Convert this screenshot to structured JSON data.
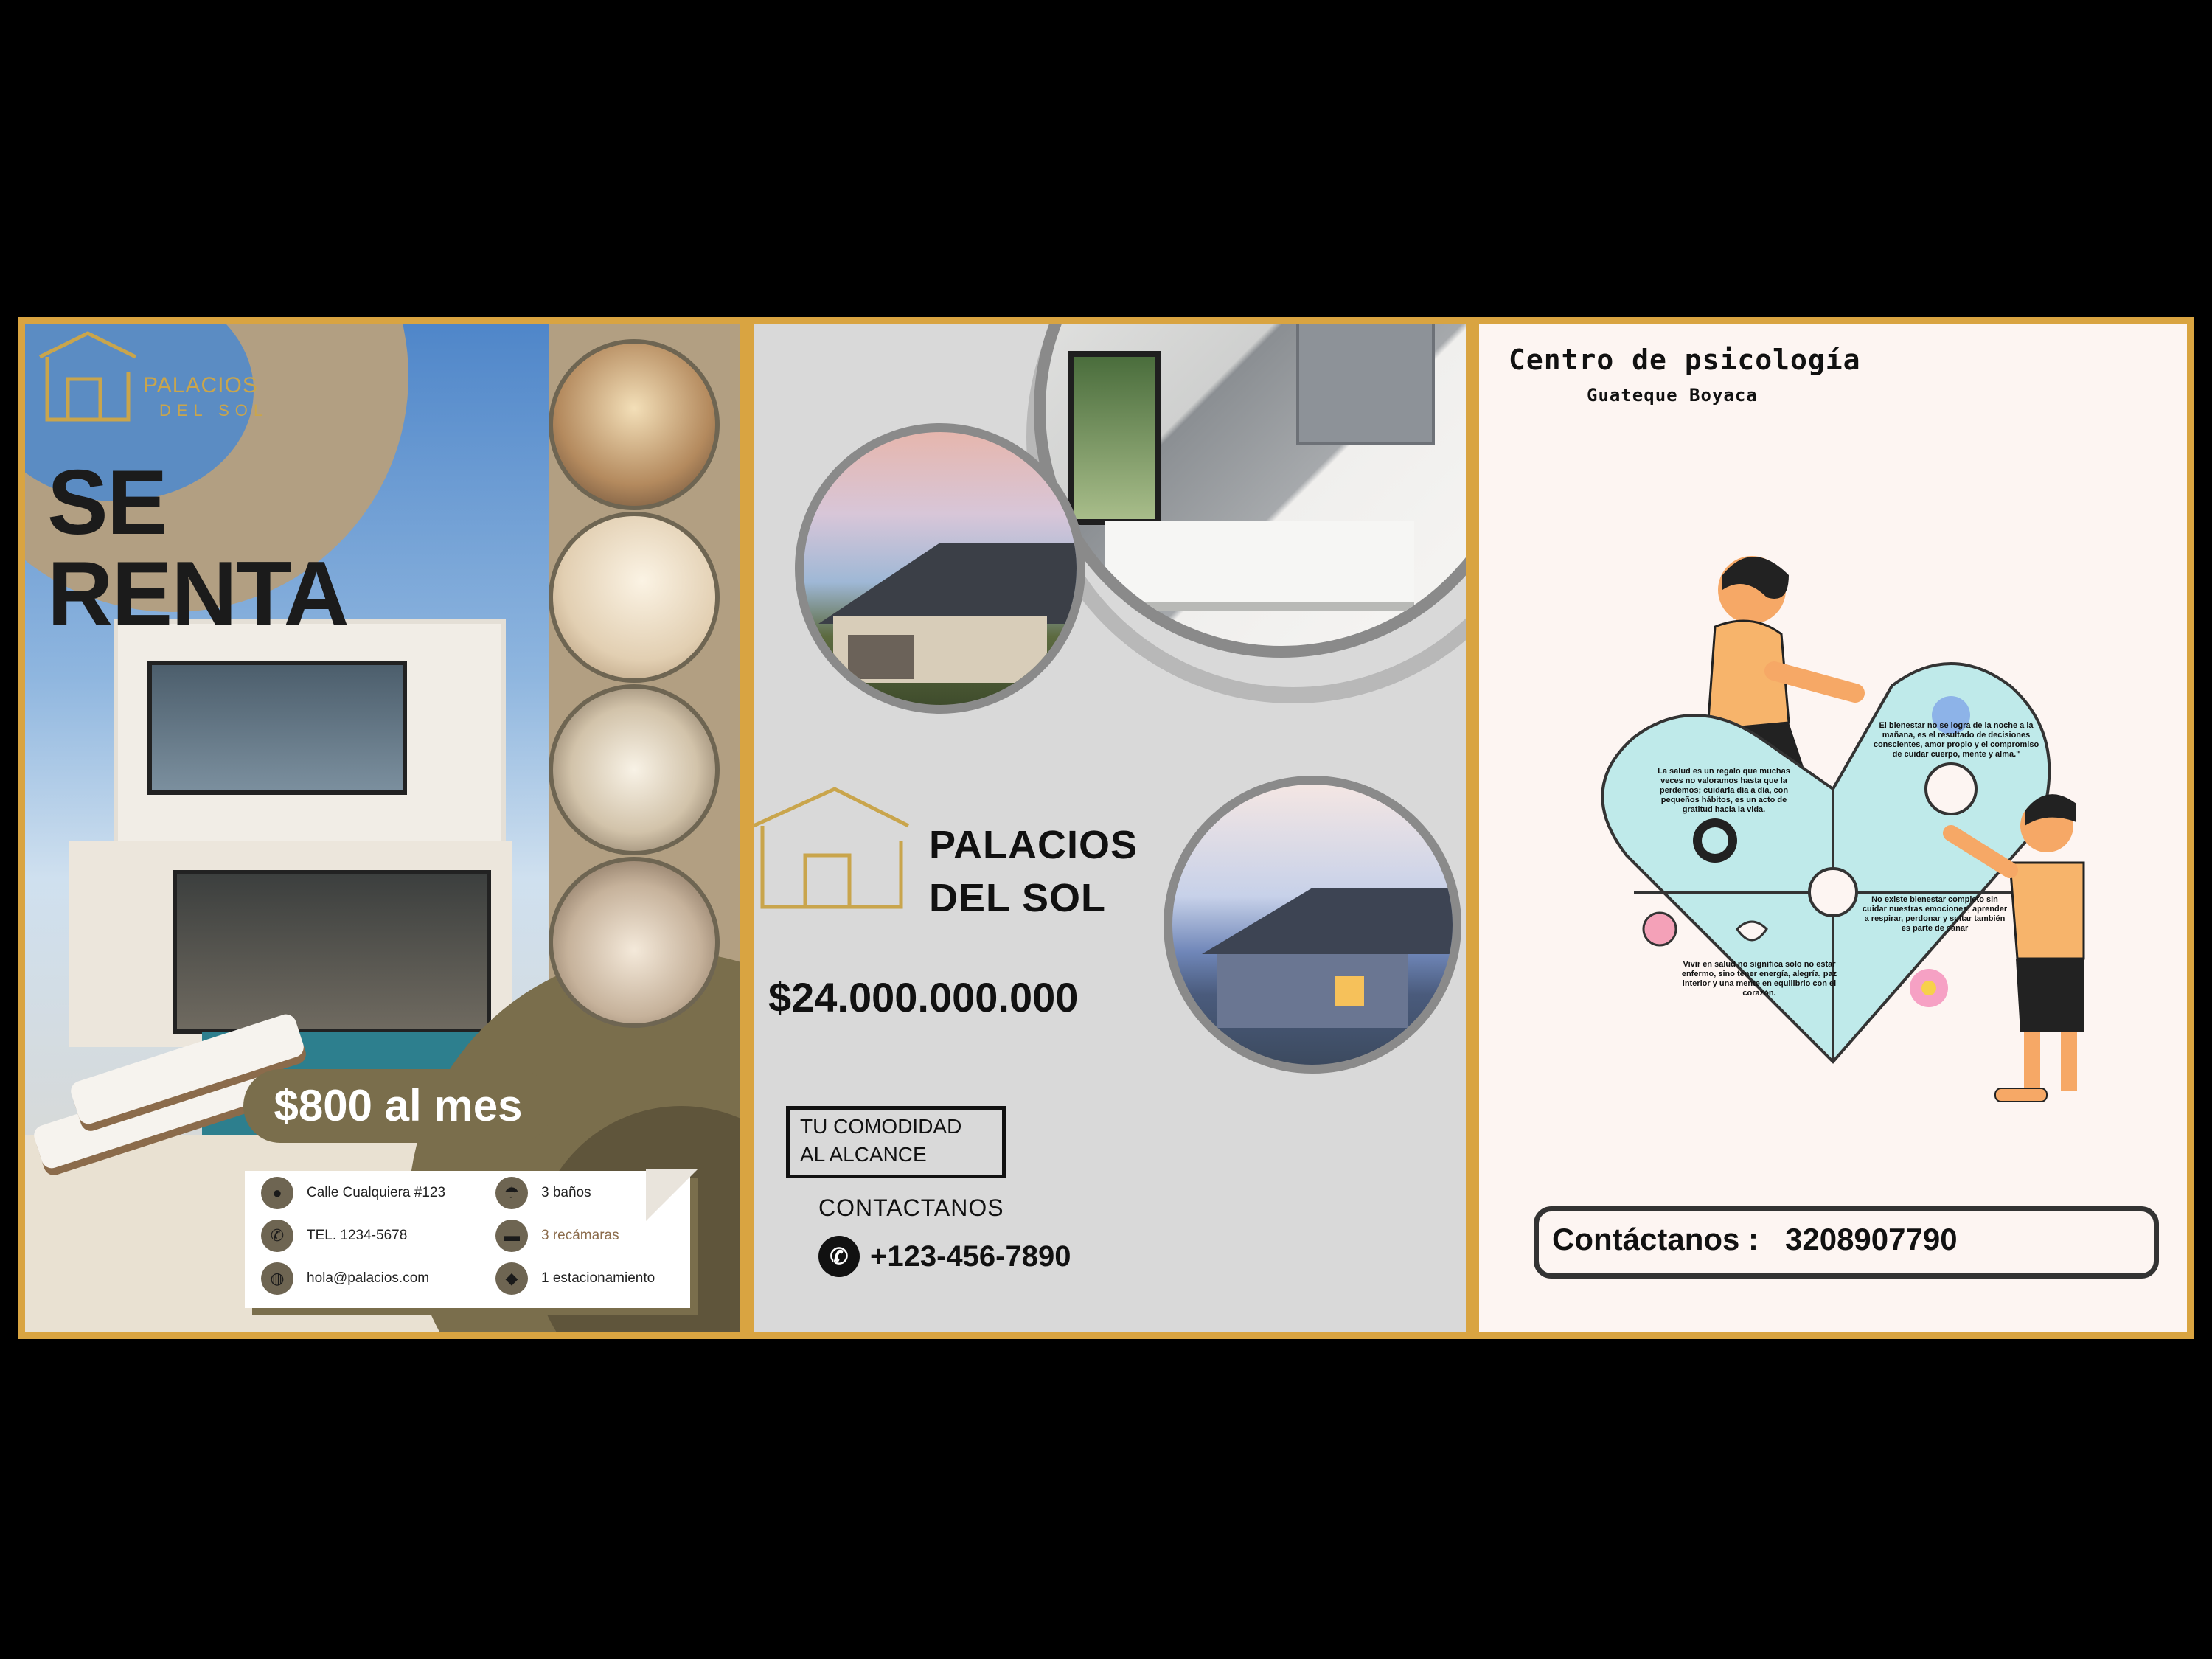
{
  "flyer_rent": {
    "brand_line1": "PALACIOS",
    "brand_line2": "DEL SOL",
    "headline_line1": "SE",
    "headline_line2": "RENTA",
    "price": "$800 al mes",
    "info": {
      "address": "Calle Cualquiera #123",
      "phone": "TEL. 1234-5678",
      "email": "hola@palacios.com",
      "baths": "3 baños",
      "bedrooms": "3 recámaras",
      "parking": "1 estacionamiento"
    },
    "icons": [
      "location-pin-icon",
      "phone-icon",
      "globe-icon",
      "shower-icon",
      "bed-icon",
      "car-icon"
    ],
    "colors": {
      "accent": "#7a6e4c",
      "gold": "#c9a54c"
    }
  },
  "flyer_sale": {
    "brand_line1": "PALACIOS",
    "brand_line2": "DEL SOL",
    "price": "$24.000.000.000",
    "tagline_line1": "TU COMODIDAD",
    "tagline_line2": "AL ALCANCE",
    "contact_label": "CONTACTANOS",
    "phone": "+123-456-7890"
  },
  "flyer_psych": {
    "title": "Centro de psicología",
    "subtitle": "Guateque Boyaca",
    "pieces": {
      "top_right": "El bienestar no se logra de la noche a la mañana, es el resultado de decisiones conscientes, amor propio y el compromiso de cuidar cuerpo, mente y alma.\"",
      "left": "La salud es un regalo que muchas veces no valoramos hasta que la perdemos; cuidarla día a día, con pequeños hábitos, es un acto de gratitud hacia la vida.",
      "bottom_right": "No existe bienestar completo sin cuidar nuestras emociones; aprender a respirar, perdonar y soltar también es parte de sanar",
      "bottom_left": "Vivir en salud no significa solo no estar enfermo, sino tener energía, alegría, paz interior y una mente en equilibrio con el corazón."
    },
    "contact_label": "Contáctanos :",
    "contact_phone": "3208907790",
    "colors": {
      "puzzle": "#bfeaea",
      "skin": "#f6a866",
      "shirt": "#f7b46b"
    }
  }
}
